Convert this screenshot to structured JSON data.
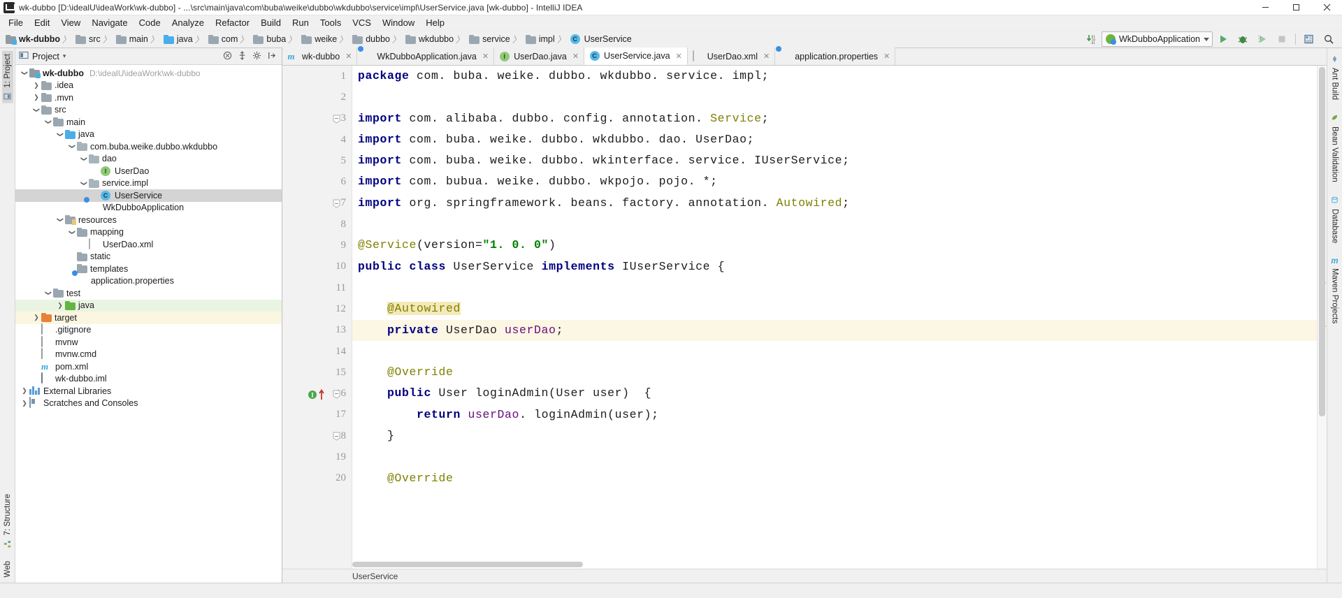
{
  "window": {
    "title": "wk-dubbo [D:\\idealU\\ideaWork\\wk-dubbo] - ...\\src\\main\\java\\com\\buba\\weike\\dubbo\\wkdubbo\\service\\impl\\UserService.java [wk-dubbo] - IntelliJ IDEA",
    "minimize": "─",
    "maximize": "☐",
    "close": "✕"
  },
  "menubar": {
    "items": [
      {
        "label": "File"
      },
      {
        "label": "Edit"
      },
      {
        "label": "View"
      },
      {
        "label": "Navigate"
      },
      {
        "label": "Code"
      },
      {
        "label": "Analyze"
      },
      {
        "label": "Refactor"
      },
      {
        "label": "Build"
      },
      {
        "label": "Run"
      },
      {
        "label": "Tools"
      },
      {
        "label": "VCS"
      },
      {
        "label": "Window"
      },
      {
        "label": "Help"
      }
    ]
  },
  "navbar": {
    "breadcrumbs": [
      {
        "label": "wk-dubbo",
        "icon": "module-folder-icon",
        "kind": "module"
      },
      {
        "label": "src",
        "icon": "folder-icon",
        "kind": "folder"
      },
      {
        "label": "main",
        "icon": "folder-icon",
        "kind": "folder"
      },
      {
        "label": "java",
        "icon": "source-folder-icon",
        "kind": "source"
      },
      {
        "label": "com",
        "icon": "folder-icon",
        "kind": "folder"
      },
      {
        "label": "buba",
        "icon": "folder-icon",
        "kind": "folder"
      },
      {
        "label": "weike",
        "icon": "folder-icon",
        "kind": "folder"
      },
      {
        "label": "dubbo",
        "icon": "folder-icon",
        "kind": "folder"
      },
      {
        "label": "wkdubbo",
        "icon": "folder-icon",
        "kind": "folder"
      },
      {
        "label": "service",
        "icon": "folder-icon",
        "kind": "folder"
      },
      {
        "label": "impl",
        "icon": "folder-icon",
        "kind": "folder"
      },
      {
        "label": "UserService",
        "icon": "class-icon",
        "kind": "class"
      }
    ],
    "separator": "〉",
    "run_config": {
      "label": "WkDubboApplication",
      "icon": "spring-boot-icon"
    },
    "buttons": [
      {
        "name": "update-project-icon",
        "label": ""
      },
      {
        "name": "run-button",
        "label": "▶"
      },
      {
        "name": "debug-button",
        "label": ""
      },
      {
        "name": "run-coverage-button",
        "label": ""
      },
      {
        "name": "stop-button",
        "label": ""
      },
      {
        "name": "layout-button",
        "label": ""
      },
      {
        "name": "search-button",
        "label": ""
      }
    ]
  },
  "left_strip": {
    "top": [
      {
        "label": "1: Project",
        "icon": "project-icon"
      }
    ],
    "bottom": [
      {
        "label": "7: Structure",
        "icon": "structure-icon"
      },
      {
        "label": "Web",
        "icon": "web-icon"
      }
    ]
  },
  "right_strip": {
    "items": [
      {
        "label": "Ant Build",
        "icon": "ant-icon",
        "color": "#7a9ec4"
      },
      {
        "label": "Bean Validation",
        "icon": "bean-icon",
        "color": "#79a84b"
      },
      {
        "label": "Database",
        "icon": "database-icon",
        "color": "#4aaee8"
      },
      {
        "label": "Maven Projects",
        "icon": "maven-icon",
        "color": "#3aa5dd"
      }
    ]
  },
  "project_panel": {
    "title": "Project",
    "dropdown_caret": "▾",
    "tools": [
      {
        "name": "collapse-all-icon",
        "label": "⊖"
      },
      {
        "name": "expand-all-icon",
        "label": "⊕"
      },
      {
        "name": "settings-gear-icon",
        "label": "⚙"
      },
      {
        "name": "hide-panel-icon",
        "label": "⇥"
      }
    ],
    "tree": [
      {
        "indent": 0,
        "arrow": "down",
        "icon": "module-folder-icon",
        "label": "wk-dubbo",
        "bold": true,
        "path": "D:\\idealU\\ideaWork\\wk-dubbo",
        "state": "normal"
      },
      {
        "indent": 1,
        "arrow": "right",
        "icon": "folder-icon",
        "label": ".idea",
        "state": "normal"
      },
      {
        "indent": 1,
        "arrow": "right",
        "icon": "folder-icon",
        "label": ".mvn",
        "state": "normal"
      },
      {
        "indent": 1,
        "arrow": "down",
        "icon": "folder-icon",
        "label": "src",
        "state": "normal"
      },
      {
        "indent": 2,
        "arrow": "down",
        "icon": "folder-icon",
        "label": "main",
        "state": "normal"
      },
      {
        "indent": 3,
        "arrow": "down",
        "icon": "source-folder-icon",
        "label": "java",
        "state": "normal"
      },
      {
        "indent": 4,
        "arrow": "down",
        "icon": "package-icon",
        "label": "com.buba.weike.dubbo.wkdubbo",
        "state": "normal"
      },
      {
        "indent": 5,
        "arrow": "down",
        "icon": "package-icon",
        "label": "dao",
        "state": "normal"
      },
      {
        "indent": 6,
        "arrow": "none",
        "icon": "interface-icon",
        "label": "UserDao",
        "state": "normal"
      },
      {
        "indent": 5,
        "arrow": "down",
        "icon": "package-icon",
        "label": "service.impl",
        "state": "normal"
      },
      {
        "indent": 6,
        "arrow": "none",
        "icon": "class-icon",
        "label": "UserService",
        "state": "selected"
      },
      {
        "indent": 5,
        "arrow": "none",
        "icon": "spring-boot-icon",
        "label": "WkDubboApplication",
        "state": "normal"
      },
      {
        "indent": 3,
        "arrow": "down",
        "icon": "resources-folder-icon",
        "label": "resources",
        "state": "normal"
      },
      {
        "indent": 4,
        "arrow": "down",
        "icon": "folder-icon",
        "label": "mapping",
        "state": "normal"
      },
      {
        "indent": 5,
        "arrow": "none",
        "icon": "xml-file-icon",
        "label": "UserDao.xml",
        "state": "normal"
      },
      {
        "indent": 4,
        "arrow": "none",
        "icon": "folder-icon",
        "label": "static",
        "state": "normal"
      },
      {
        "indent": 4,
        "arrow": "none",
        "icon": "folder-icon",
        "label": "templates",
        "state": "normal"
      },
      {
        "indent": 4,
        "arrow": "none",
        "icon": "properties-file-icon",
        "label": "application.properties",
        "state": "normal"
      },
      {
        "indent": 2,
        "arrow": "down",
        "icon": "folder-icon",
        "label": "test",
        "state": "normal"
      },
      {
        "indent": 3,
        "arrow": "right",
        "icon": "test-source-folder-icon",
        "label": "java",
        "state": "green"
      },
      {
        "indent": 1,
        "arrow": "right",
        "icon": "target-folder-icon",
        "label": "target",
        "state": "yellow"
      },
      {
        "indent": 1,
        "arrow": "none",
        "icon": "text-file-icon",
        "label": ".gitignore",
        "state": "normal"
      },
      {
        "indent": 1,
        "arrow": "none",
        "icon": "text-file-icon",
        "label": "mvnw",
        "state": "normal"
      },
      {
        "indent": 1,
        "arrow": "none",
        "icon": "text-file-icon",
        "label": "mvnw.cmd",
        "state": "normal"
      },
      {
        "indent": 1,
        "arrow": "none",
        "icon": "maven-file-icon",
        "label": "pom.xml",
        "state": "normal"
      },
      {
        "indent": 1,
        "arrow": "none",
        "icon": "iml-file-icon",
        "label": "wk-dubbo.iml",
        "state": "normal"
      },
      {
        "indent": 0,
        "arrow": "right",
        "icon": "external-libraries-icon",
        "label": "External Libraries",
        "state": "normal"
      },
      {
        "indent": 0,
        "arrow": "right",
        "icon": "scratches-icon",
        "label": "Scratches and Consoles",
        "state": "normal"
      }
    ]
  },
  "editor": {
    "tabs": [
      {
        "label": "wk-dubbo",
        "icon": "maven-file-icon",
        "active": false,
        "close": "✕"
      },
      {
        "label": "WkDubboApplication.java",
        "icon": "spring-boot-icon",
        "active": false,
        "close": "✕"
      },
      {
        "label": "UserDao.java",
        "icon": "interface-icon",
        "active": false,
        "close": "✕"
      },
      {
        "label": "UserService.java",
        "icon": "class-icon",
        "active": true,
        "close": "✕"
      },
      {
        "label": "UserDao.xml",
        "icon": "xml-file-icon",
        "active": false,
        "close": "✕"
      },
      {
        "label": "application.properties",
        "icon": "properties-file-icon",
        "active": false,
        "close": "✕"
      }
    ],
    "breadcrumb_bottom": "UserService",
    "lines": [
      {
        "n": 1,
        "tokens": [
          {
            "t": "package",
            "c": "kw"
          },
          {
            "t": " com. buba. weike. dubbo. wkdubbo. service. impl;",
            "c": "plain"
          }
        ]
      },
      {
        "n": 2,
        "tokens": []
      },
      {
        "n": 3,
        "tokens": [
          {
            "t": "import",
            "c": "kw"
          },
          {
            "t": " com. alibaba. dubbo. config. annotation. ",
            "c": "plain"
          },
          {
            "t": "Service",
            "c": "ann"
          },
          {
            "t": ";",
            "c": "plain"
          }
        ]
      },
      {
        "n": 4,
        "tokens": [
          {
            "t": "import",
            "c": "kw"
          },
          {
            "t": " com. buba. weike. dubbo. wkdubbo. dao. UserDao;",
            "c": "plain"
          }
        ]
      },
      {
        "n": 5,
        "tokens": [
          {
            "t": "import",
            "c": "kw"
          },
          {
            "t": " com. buba. weike. dubbo. wkinterface. service. IUserService;",
            "c": "plain"
          }
        ]
      },
      {
        "n": 6,
        "tokens": [
          {
            "t": "import",
            "c": "kw"
          },
          {
            "t": " com. bubua. weike. dubbo. wkpojo. pojo. *;",
            "c": "plain"
          }
        ]
      },
      {
        "n": 7,
        "tokens": [
          {
            "t": "import",
            "c": "kw"
          },
          {
            "t": " org. springframework. beans. factory. annotation. ",
            "c": "plain"
          },
          {
            "t": "Autowired",
            "c": "ann"
          },
          {
            "t": ";",
            "c": "plain"
          }
        ]
      },
      {
        "n": 8,
        "tokens": []
      },
      {
        "n": 9,
        "tokens": [
          {
            "t": "@Service",
            "c": "ann"
          },
          {
            "t": "(version=",
            "c": "plain"
          },
          {
            "t": "\"1. 0. 0\"",
            "c": "str"
          },
          {
            "t": ")",
            "c": "plain"
          }
        ]
      },
      {
        "n": 10,
        "tokens": [
          {
            "t": "public class",
            "c": "kw"
          },
          {
            "t": " UserService ",
            "c": "plain"
          },
          {
            "t": "implements",
            "c": "kw"
          },
          {
            "t": " IUserService {",
            "c": "plain"
          }
        ]
      },
      {
        "n": 11,
        "tokens": []
      },
      {
        "n": 12,
        "tokens": [
          {
            "t": "    ",
            "c": "plain"
          },
          {
            "t": "@Autowired",
            "c": "ann mark-aut"
          }
        ]
      },
      {
        "n": 13,
        "tokens": [
          {
            "t": "    ",
            "c": "plain"
          },
          {
            "t": "private",
            "c": "kw"
          },
          {
            "t": " UserDao ",
            "c": "plain"
          },
          {
            "t": "userDao",
            "c": "fld"
          },
          {
            "t": ";",
            "c": "plain"
          }
        ]
      },
      {
        "n": 14,
        "tokens": []
      },
      {
        "n": 15,
        "tokens": [
          {
            "t": "    ",
            "c": "plain"
          },
          {
            "t": "@Override",
            "c": "ann"
          }
        ]
      },
      {
        "n": 16,
        "tokens": [
          {
            "t": "    ",
            "c": "plain"
          },
          {
            "t": "public",
            "c": "kw"
          },
          {
            "t": " User loginAdmin(User user)  {",
            "c": "plain"
          }
        ]
      },
      {
        "n": 17,
        "tokens": [
          {
            "t": "        ",
            "c": "plain"
          },
          {
            "t": "return",
            "c": "kw"
          },
          {
            "t": " ",
            "c": "plain"
          },
          {
            "t": "userDao",
            "c": "fld"
          },
          {
            "t": ". loginAdmin(user);",
            "c": "plain"
          }
        ]
      },
      {
        "n": 18,
        "tokens": [
          {
            "t": "    }",
            "c": "plain"
          }
        ]
      },
      {
        "n": 19,
        "tokens": []
      },
      {
        "n": 20,
        "tokens": [
          {
            "t": "    ",
            "c": "plain"
          },
          {
            "t": "@Override",
            "c": "ann"
          }
        ]
      }
    ],
    "gutter_markers": [
      {
        "line": 3,
        "type": "fold-collapse"
      },
      {
        "line": 7,
        "type": "fold-end"
      },
      {
        "line": 16,
        "type": "fold-collapse",
        "bulb": "implementing-method-icon",
        "bulb_label": "I"
      },
      {
        "line": 18,
        "type": "fold-end"
      }
    ],
    "highlight_lines": [
      13
    ]
  },
  "statusbar": {
    "left": "",
    "items": []
  },
  "colors": {
    "keyword": "#000080",
    "annotation": "#808000",
    "string": "#008000",
    "field": "#660e7a",
    "selection": "#d4d4d4",
    "caret_row": "#fcf6e4",
    "accent_green": "#62b543",
    "accent_blue": "#4aaee8"
  }
}
